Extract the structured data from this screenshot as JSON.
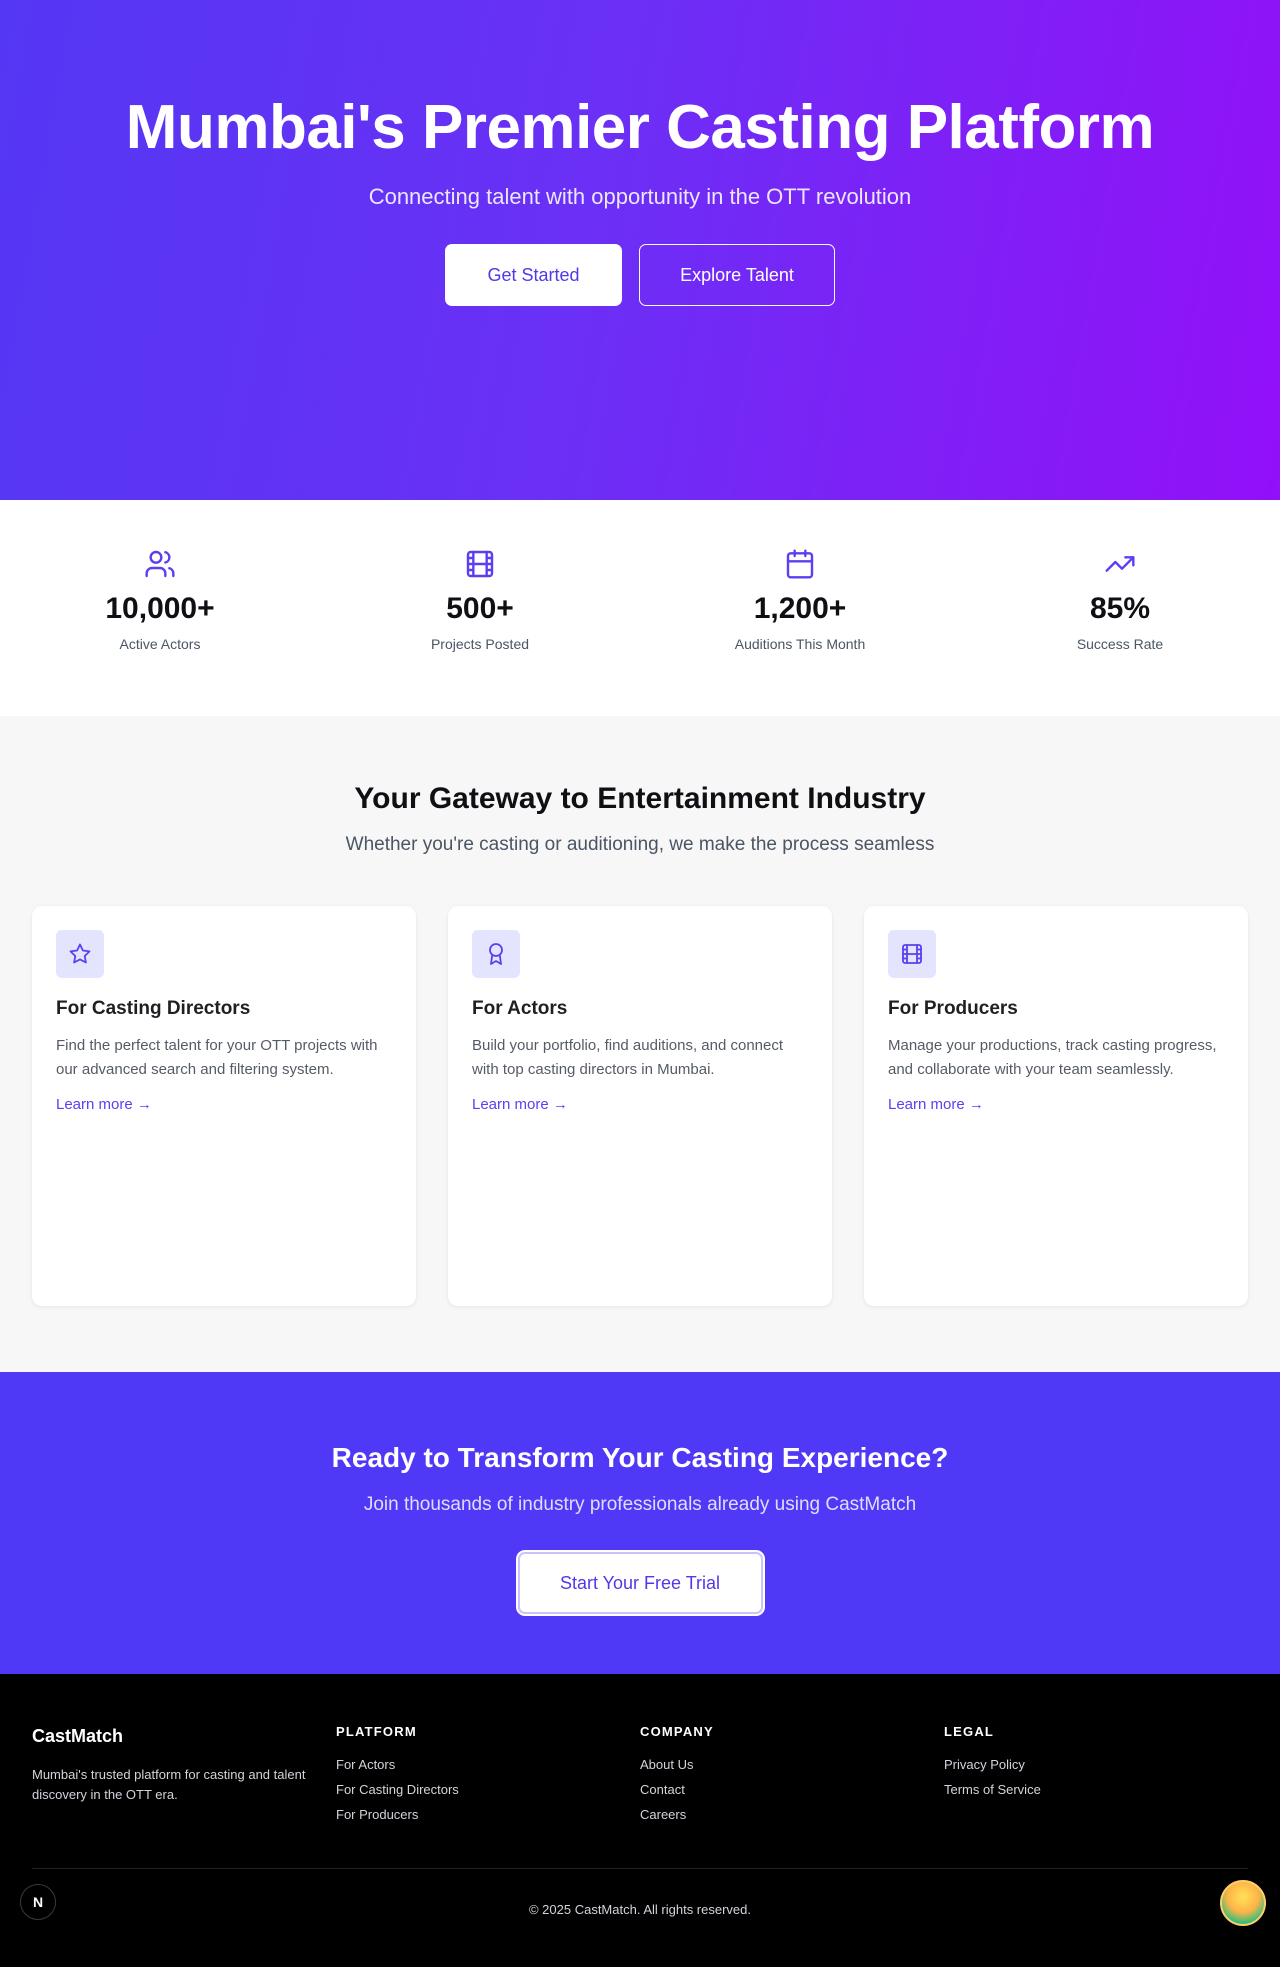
{
  "hero": {
    "title": "Mumbai's Premier Casting Platform",
    "subtitle": "Connecting talent with opportunity in the OTT revolution",
    "primary_button": "Get Started",
    "secondary_button": "Explore Talent"
  },
  "stats": [
    {
      "icon": "users-icon",
      "value": "10,000+",
      "label": "Active Actors"
    },
    {
      "icon": "film-icon",
      "value": "500+",
      "label": "Projects Posted"
    },
    {
      "icon": "calendar-icon",
      "value": "1,200+",
      "label": "Auditions This Month"
    },
    {
      "icon": "trending-up-icon",
      "value": "85%",
      "label": "Success Rate"
    }
  ],
  "features": {
    "title": "Your Gateway to Entertainment Industry",
    "subtitle": "Whether you're casting or auditioning, we make the process seamless",
    "cards": [
      {
        "icon": "star-icon",
        "title": "For Casting Directors",
        "description": "Find the perfect talent for your OTT projects with our advanced search and filtering system.",
        "link": "Learn more →"
      },
      {
        "icon": "award-icon",
        "title": "For Actors",
        "description": "Build your portfolio, find auditions, and connect with top casting directors in Mumbai.",
        "link": "Learn more →"
      },
      {
        "icon": "film-icon",
        "title": "For Producers",
        "description": "Manage your productions, track casting progress, and collaborate with your team seamlessly.",
        "link": "Learn more →"
      }
    ]
  },
  "cta": {
    "title": "Ready to Transform Your Casting Experience?",
    "subtitle": "Join thousands of industry professionals already using CastMatch",
    "button": "Start Your Free Trial"
  },
  "footer": {
    "brand": "CastMatch",
    "tagline": "Mumbai's trusted platform for casting and talent discovery in the OTT era.",
    "columns": [
      {
        "heading": "PLATFORM",
        "links": [
          "For Actors",
          "For Casting Directors",
          "For Producers"
        ]
      },
      {
        "heading": "COMPANY",
        "links": [
          "About Us",
          "Contact",
          "Careers"
        ]
      },
      {
        "heading": "LEGAL",
        "links": [
          "Privacy Policy",
          "Terms of Service"
        ]
      }
    ],
    "copyright": "© 2025 CastMatch. All rights reserved."
  },
  "floating": {
    "left_badge": "N"
  },
  "colors": {
    "accent": "#4f39f6",
    "hero_gradient_start": "#5437f4",
    "hero_gradient_end": "#9310f8"
  }
}
